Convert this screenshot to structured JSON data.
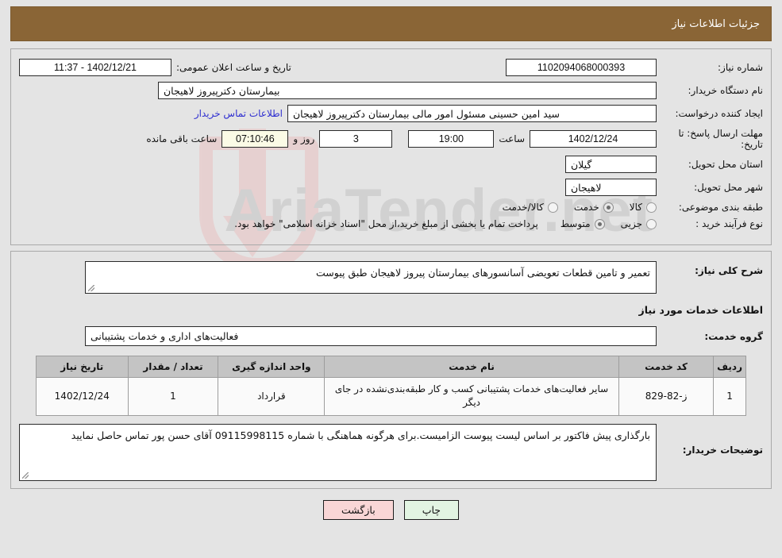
{
  "header": {
    "title": "جزئیات اطلاعات نیاز"
  },
  "form": {
    "need_number_label": "شماره نیاز:",
    "need_number_value": "1102094068000393",
    "public_announce_label": "تاریخ و ساعت اعلان عمومی:",
    "public_announce_value": "1402/12/21 - 11:37",
    "buyer_org_label": "نام دستگاه خریدار:",
    "buyer_org_value": "بیمارستان دکترپیروز لاهیجان",
    "requester_label": "ایجاد کننده درخواست:",
    "requester_value": "سید امین حسینی مسئول امور مالی بیمارستان دکترپیروز لاهیجان",
    "contact_link": "اطلاعات تماس خریدار",
    "deadline_label": "مهلت ارسال پاسخ: تا تاریخ:",
    "deadline_date": "1402/12/24",
    "hour_label": "ساعت",
    "deadline_time": "19:00",
    "days_value": "3",
    "days_label": "روز و",
    "countdown_value": "07:10:46",
    "remaining_label": "ساعت باقی مانده",
    "province_label": "استان محل تحویل:",
    "province_value": "گیلان",
    "city_label": "شهر محل تحویل:",
    "city_value": "لاهیجان",
    "category_label": "طبقه بندی موضوعی:",
    "category_options": [
      {
        "label": "کالا",
        "selected": false
      },
      {
        "label": "خدمت",
        "selected": true
      },
      {
        "label": "کالا/خدمت",
        "selected": false
      }
    ],
    "process_label": "نوع فرآیند خرید :",
    "process_options": [
      {
        "label": "جزیی",
        "selected": false
      },
      {
        "label": "متوسط",
        "selected": true
      }
    ],
    "process_note": "پرداخت تمام یا بخشی از مبلغ خرید،از محل \"اسناد خزانه اسلامی\" خواهد بود."
  },
  "details": {
    "general_desc_label": "شرح کلی نیاز:",
    "general_desc_value": "تعمیر و تامین قطعات تعویضی آسانسورهای بیمارستان پیروز لاهیجان طبق پیوست",
    "services_section_title": "اطلاعات خدمات مورد نیاز",
    "service_group_label": "گروه خدمت:",
    "service_group_value": "فعالیت‌های اداری و خدمات پشتیبانی"
  },
  "table": {
    "columns": [
      "ردیف",
      "کد خدمت",
      "نام خدمت",
      "واحد اندازه گیری",
      "تعداد / مقدار",
      "تاریخ نیاز"
    ],
    "rows": [
      {
        "radif": "1",
        "code": "ز-82-829",
        "name": "سایر فعالیت‌های خدمات پشتیبانی کسب و کار طبقه‌بندی‌نشده در جای دیگر",
        "unit": "قرارداد",
        "qty": "1",
        "date": "1402/12/24"
      }
    ]
  },
  "buyer_notes": {
    "label": "توضیحات خریدار:",
    "value": "بارگذاری پیش فاکتور بر اساس لیست پیوست الزامیست.برای هرگونه هماهنگی با شماره 09115998115 آقای حسن پور تماس حاصل نمایید"
  },
  "buttons": {
    "print": "چاپ",
    "back": "بازگشت"
  },
  "watermark": {
    "text": "AriaTender.net"
  }
}
